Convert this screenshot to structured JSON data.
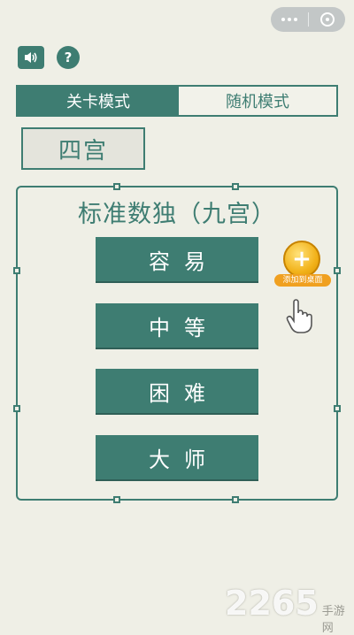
{
  "capsule": {
    "menu_icon": "more-dots-icon",
    "close_icon": "close-circle-icon"
  },
  "toolbar": {
    "sound_icon": "speaker-icon",
    "help_label": "?"
  },
  "mode_tabs": [
    {
      "label": "关卡模式",
      "active": true
    },
    {
      "label": "随机模式",
      "active": false
    }
  ],
  "grid_size": "四宫",
  "frame": {
    "title": "标准数独（九宫）",
    "levels": [
      "容易",
      "中等",
      "困难",
      "大师"
    ]
  },
  "add_to_desktop": {
    "plus": "+",
    "label": "添加到桌面"
  },
  "watermark": {
    "number": "2265",
    "site": "手游网"
  },
  "colors": {
    "primary": "#3e7d72",
    "background": "#efefe6",
    "coin": "#f2b21a"
  }
}
